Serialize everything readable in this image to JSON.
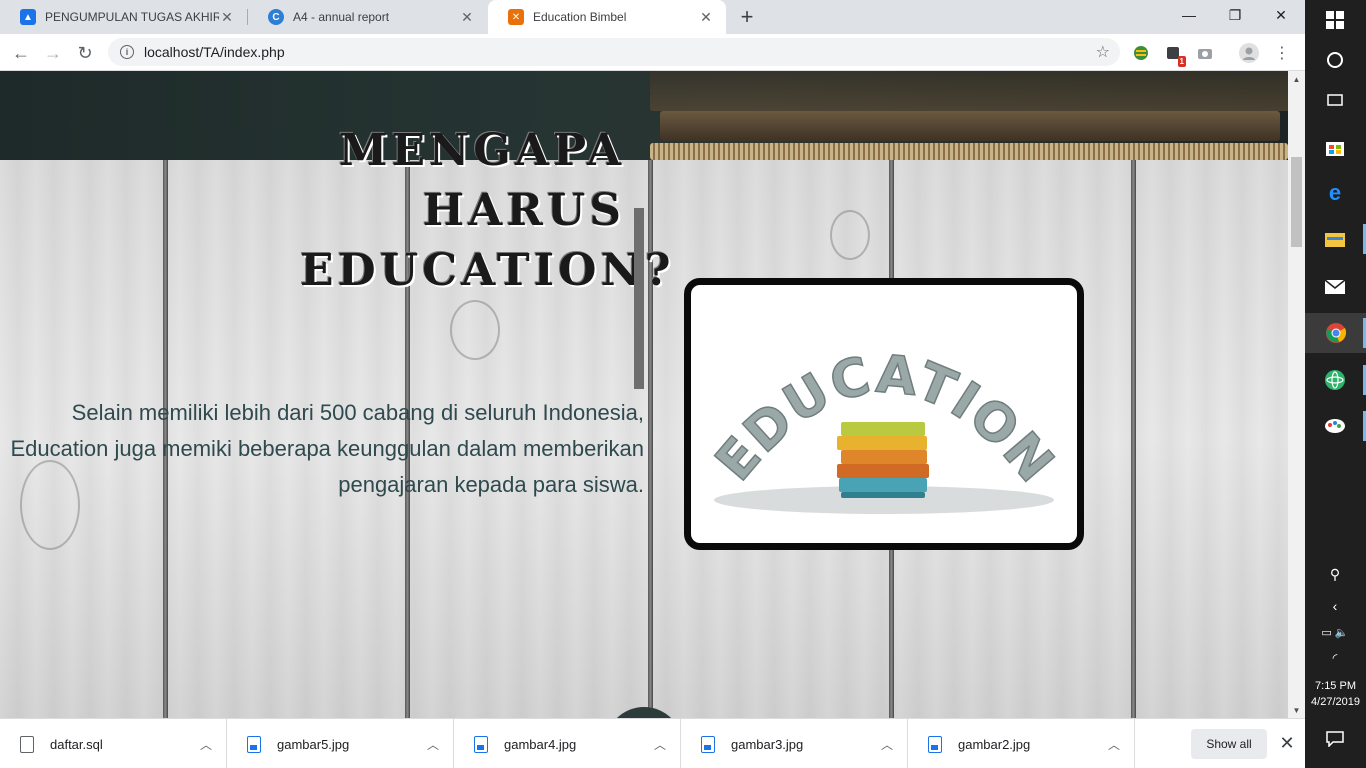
{
  "tabs": [
    {
      "title": "PENGUMPULAN TUGAS AKHIR V",
      "favicon_color": "#1a73e8",
      "favicon_icon": "classroom-icon",
      "active": false
    },
    {
      "title": "A4 - annual report",
      "favicon_color": "#2d7fd6",
      "favicon_icon": "canva-icon",
      "active": false
    },
    {
      "title": "Education Bimbel",
      "favicon_color": "#e8710a",
      "favicon_icon": "xampp-icon",
      "active": true
    }
  ],
  "toolbar": {
    "url": "localhost/TA/index.php",
    "extension_badge": "1"
  },
  "page": {
    "heading_lines": [
      "MENGAPA",
      "HARUS",
      "EDUCATION?"
    ],
    "description": "Selain memiliki lebih dari 500 cabang di seluruh Indonesia, Education juga memiki beberapa keunggulan dalam memberikan pengajaran kepada para siswa.",
    "image_word": "EDUCATION"
  },
  "downloads": [
    {
      "name": "daftar.sql",
      "type": "file"
    },
    {
      "name": "gambar5.jpg",
      "type": "image"
    },
    {
      "name": "gambar4.jpg",
      "type": "image"
    },
    {
      "name": "gambar3.jpg",
      "type": "image"
    },
    {
      "name": "gambar2.jpg",
      "type": "image"
    }
  ],
  "downloads_show_all": "Show all",
  "taskbar": {
    "time": "7:15 PM",
    "date": "4/27/2019"
  },
  "colors": {
    "description_text": "#2f4a4f",
    "hero_dark": "#253432",
    "accent_blue": "#76b9ed"
  }
}
